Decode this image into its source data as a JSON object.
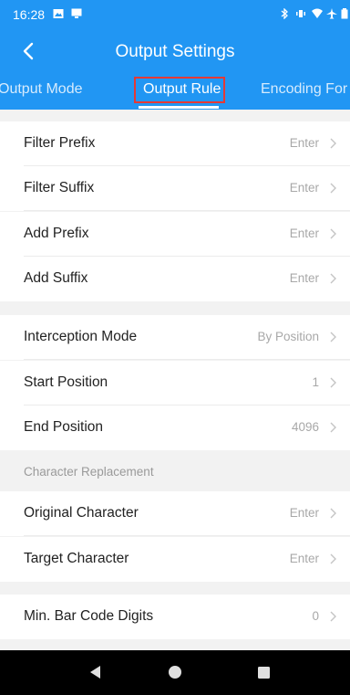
{
  "status_bar": {
    "time": "16:28",
    "right_icons": [
      "bluetooth-icon",
      "vibrate-icon",
      "wifi-icon",
      "airplane-icon",
      "battery-icon"
    ]
  },
  "header": {
    "title": "Output Settings",
    "back_icon": "chevron-left-icon"
  },
  "tabs": [
    {
      "label": "Output Mode",
      "active": false
    },
    {
      "label": "Output Rule",
      "active": true
    },
    {
      "label": "Encoding For",
      "active": false
    }
  ],
  "groups": [
    {
      "rows": [
        {
          "label": "Filter Prefix",
          "value": "Enter"
        },
        {
          "label": "Filter Suffix",
          "value": "Enter"
        },
        {
          "label": "Add Prefix",
          "value": "Enter"
        },
        {
          "label": "Add Suffix",
          "value": "Enter"
        }
      ]
    },
    {
      "rows": [
        {
          "label": "Interception Mode",
          "value": "By Position"
        },
        {
          "label": "Start Position",
          "value": "1"
        },
        {
          "label": "End Position",
          "value": "4096"
        }
      ]
    },
    {
      "header": "Character Replacement",
      "rows": [
        {
          "label": "Original Character",
          "value": "Enter"
        },
        {
          "label": "Target Character",
          "value": "Enter"
        }
      ]
    },
    {
      "rows": [
        {
          "label": "Min. Bar Code Digits",
          "value": "0"
        }
      ]
    }
  ],
  "colors": {
    "primary": "#2196f3",
    "highlight": "#e53935",
    "background": "#f2f2f2",
    "navbar": "#000000"
  },
  "nav_bar": [
    "back-triangle-icon",
    "home-circle-icon",
    "recents-square-icon"
  ]
}
